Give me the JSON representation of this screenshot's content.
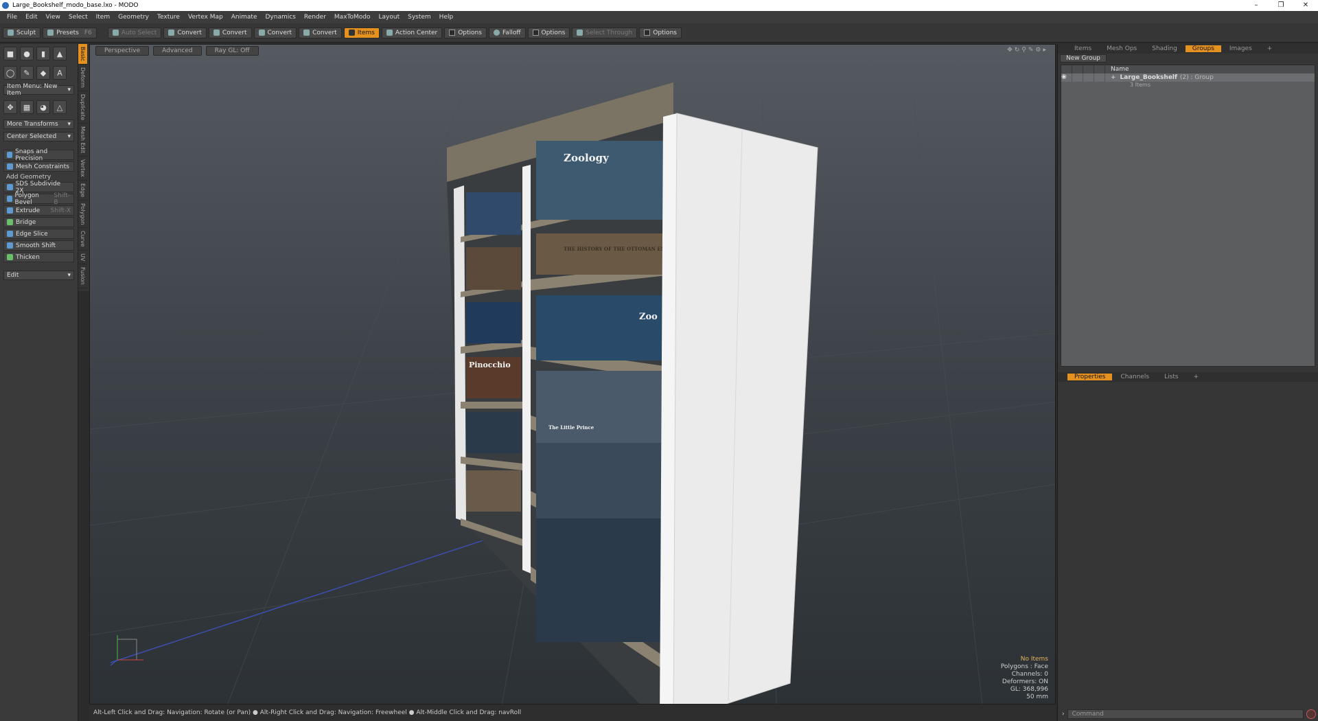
{
  "window": {
    "title": "Large_Bookshelf_modo_base.lxo - MODO",
    "controls": [
      "–",
      "❐",
      "✕"
    ]
  },
  "menu": [
    "File",
    "Edit",
    "View",
    "Select",
    "Item",
    "Geometry",
    "Texture",
    "Vertex Map",
    "Animate",
    "Dynamics",
    "Render",
    "MaxToModo",
    "Layout",
    "System",
    "Help"
  ],
  "toolbar": {
    "sculpt": "Sculpt",
    "presets": "Presets",
    "presets_key": "F6",
    "auto_select": "Auto Select",
    "convert": "Convert",
    "items": "Items",
    "action_center": "Action Center",
    "options": "Options",
    "falloff": "Falloff",
    "select_through": "Select Through"
  },
  "lefttabs": [
    "Basic",
    "Deform",
    "Duplicate",
    "Mesh Edit",
    "Vertex",
    "Edge",
    "Polygon",
    "Curve",
    "UV",
    "Fusion"
  ],
  "left": {
    "item_menu": "Item Menu: New Item",
    "more_transforms": "More Transforms",
    "center_selected": "Center Selected",
    "snaps": "Snaps and Precision",
    "mesh_constraints": "Mesh Constraints",
    "add_geometry": "Add Geometry",
    "tools": [
      {
        "label": "SDS Subdivide 2X",
        "key": ""
      },
      {
        "label": "Polygon Bevel",
        "key": "Shift-B"
      },
      {
        "label": "Extrude",
        "key": "Shift-X"
      },
      {
        "label": "Bridge",
        "key": ""
      },
      {
        "label": "Edge Slice",
        "key": ""
      },
      {
        "label": "Smooth Shift",
        "key": ""
      },
      {
        "label": "Thicken",
        "key": ""
      }
    ],
    "edit": "Edit"
  },
  "viewport": {
    "tabs": [
      "Perspective",
      "Advanced",
      "Ray GL: Off"
    ],
    "book_titles": [
      "Zoology",
      "THE HISTORY OF THE OTTOMAN EMPIRE",
      "Pinocchio",
      "Zoo",
      "The Little Prince"
    ],
    "hud": {
      "no_items": "No Items",
      "polygons": "Polygons : Face",
      "channels": "Channels: 0",
      "deformers": "Deformers: ON",
      "gl": "GL: 368,996",
      "lens": "50 mm"
    }
  },
  "status": "Alt-Left Click and Drag: Navigation: Rotate (or Pan) ● Alt-Right Click and Drag: Navigation: Freewheel ● Alt-Middle Click and Drag: navRoll",
  "right": {
    "tabs": [
      "Items",
      "Mesh Ops",
      "Shading",
      "Groups",
      "Images",
      "+"
    ],
    "new_group": "New Group",
    "name_col": "Name",
    "group": {
      "name": "Large_Bookshelf",
      "count": "(2) : Group",
      "sub": "3 Items"
    },
    "prop_tabs": [
      "Properties",
      "Channels",
      "Lists",
      "+"
    ],
    "command_placeholder": "Command"
  },
  "colors": {
    "accent": "#e59120",
    "panel": "#363636"
  }
}
